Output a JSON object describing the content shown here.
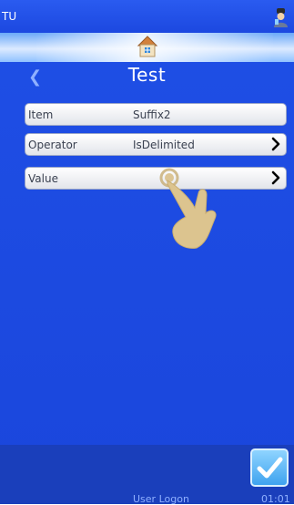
{
  "status": {
    "label": "TU"
  },
  "header": {
    "title": "Test"
  },
  "rows": [
    {
      "label": "Item",
      "value": "Suffix2"
    },
    {
      "label": "Operator",
      "value": "IsDelimited"
    },
    {
      "label": "Value",
      "value": ""
    }
  ],
  "footer": {
    "text": "User Logon",
    "time": "01:01"
  },
  "icons": {
    "user": "user-icon",
    "home": "home-icon",
    "back": "chevron-left-icon",
    "chevron": "chevron-right-icon",
    "confirm": "checkmark-icon",
    "hand": "hand-pointer-icon"
  },
  "colors": {
    "background": "#1f4fe6",
    "row": "#ffffff",
    "confirm": "#3ea3ef"
  }
}
